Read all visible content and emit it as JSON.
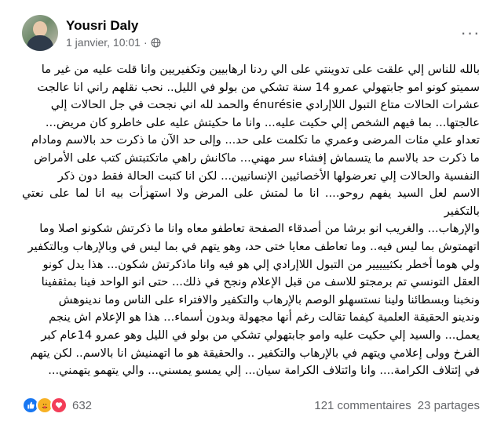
{
  "author": {
    "name": "Yousri Daly"
  },
  "post": {
    "date": "1 janvier, 10:01",
    "dot": "·",
    "more_label": "···",
    "lines": [
      "بالله للناس إلي علقت على تدوينتي على الي ردنا ارهابيين وتكفيريين وانا قلت عليه من غير ما",
      "سميتو كونو امو جابتهولي عمرو 14 سنة تشكي من بولو في الليل.. نحب نقلهم راني انا عالجت",
      "عشرات الحالات متاع التبول اللاإرادي énurésie والحمد لله اني نجحت في جل الحالات إلي",
      "عالجتها... بما فيهم الشخص إلي حكيت عليه... وانا ما حكيتش عليه على خاطرو كان مريض...",
      "تعداو علي مئات المرضى وعمري ما تكلمت على حد... وإلى حد الآن ما ذكرت حد بالاسم ومادام",
      "ما ذكرت حد بالاسم ما يتسماش إفشاء سر مهني... ماكانش راهي ماتكتبتش كتب على الأمراض",
      "النفسية والحالات إلي تعرضولها الأخصائيين الإنسانيين... لكن انا كتبت الحالة فقط دون ذكر",
      "الاسم لعل السيد يفهم روحو.... انا ما لمتش على المرض ولا استهزأت بيه انا لما على نعتي بالتكفير",
      "والإرهاب... والغريب انو برشا من أصدقاء الصفحة تعاطفو معاه وانا ما ذكرتش شكونو اصلا وما",
      "اتهمتوش بما ليس فيه.. وما تعاطف معايا ختى حد، وهو يتهم في بما ليس في وبالإرهاب وبالتكفير",
      "ولي هوما أخطر بكثييييير من التبول اللاإرادي إلي هو فيه وانا ماذكرتش شكون... هذا يدل كونو",
      "العقل التونسي تم برمجتو للاسف من قبل الإعلام ونجح في ذلك... حتى انو الواحد فينا بمثقفينا",
      "ونخبنا وبسطائنا ولينا نستسهلو الوصم بالإرهاب والتكفير والافتراء على الناس وما ندينوهش",
      "وندينو الحقيقة العلمية كيفما تقالت رغم أنها مجهولة وبدون أسماء... هذا هو الإعلام اش ينجم",
      "يعمل... والسيد إلي حكيت عليه وامو جابتهولي تشكي من بولو في الليل وهو عمرو 14عام كبر",
      "الفرخ وولى إعلامي ويتهم في بالإرهاب والتكفير .. والحقيقة هو ما اتهمنيش انا بالاسم.. لكن يتهم",
      "في إئتلاف الكرامة.... وانا وائتلاف الكرامة سيان... إلي يمسو يمسني... والي يتهمو يتهمني..."
    ]
  },
  "footer": {
    "reaction_count": "632",
    "comments": "121 commentaires",
    "shares": "23 partages"
  },
  "colors": {
    "like": "#1877f2",
    "care": "#f7b125",
    "love": "#f33e58",
    "secondary_text": "#65676b"
  }
}
